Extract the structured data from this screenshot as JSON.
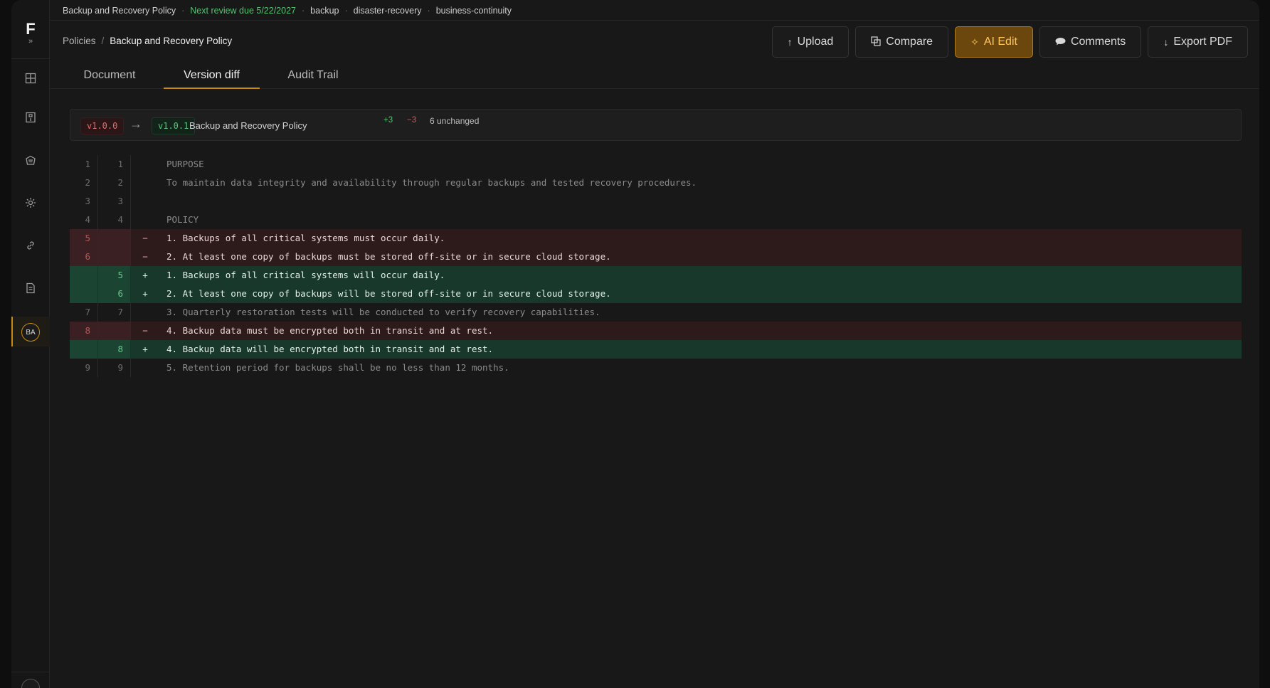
{
  "meta": {
    "doc_title": "Backup and Recovery Policy",
    "review": "Next review due 5/22/2027",
    "tags": [
      "backup",
      "disaster-recovery",
      "business-continuity"
    ]
  },
  "breadcrumb": {
    "parent": "Policies",
    "current": "Backup and Recovery Policy"
  },
  "sidebar": {
    "logo": "F",
    "logo_sub": "»",
    "avatar": "BA",
    "icons": [
      "dashboard-icon",
      "book-icon",
      "badge-icon",
      "gear-icon",
      "link-icon",
      "document-icon"
    ]
  },
  "actions": {
    "upload": "Upload",
    "compare": "Compare",
    "ai_edit": "AI Edit",
    "comments": "Comments",
    "export": "Export PDF"
  },
  "tabs": [
    {
      "label": "Document"
    },
    {
      "label": "Version diff"
    },
    {
      "label": "Audit Trail"
    }
  ],
  "active_tab": "Version diff",
  "version_bar": {
    "from": "v1.0.0",
    "to": "v1.0.1",
    "title": "Backup and Recovery Policy",
    "added": "+3",
    "removed": "−3",
    "unchanged": "6 unchanged"
  },
  "diff": [
    {
      "type": "ctx",
      "old": "1",
      "new": "1",
      "text": "PURPOSE"
    },
    {
      "type": "ctx",
      "old": "2",
      "new": "2",
      "text": "To maintain data integrity and availability through regular backups and tested recovery procedures."
    },
    {
      "type": "ctx",
      "old": "3",
      "new": "3",
      "text": ""
    },
    {
      "type": "ctx",
      "old": "4",
      "new": "4",
      "text": "POLICY"
    },
    {
      "type": "del",
      "old": "5",
      "new": "",
      "marker": "−",
      "text": "1. Backups of all critical systems must occur daily."
    },
    {
      "type": "del",
      "old": "6",
      "new": "",
      "marker": "−",
      "text": "2. At least one copy of backups must be stored off-site or in secure cloud storage."
    },
    {
      "type": "add",
      "old": "",
      "new": "5",
      "marker": "+",
      "text": "1. Backups of all critical systems will occur daily."
    },
    {
      "type": "add",
      "old": "",
      "new": "6",
      "marker": "+",
      "text": "2. At least one copy of backups will be stored off-site or in secure cloud storage."
    },
    {
      "type": "ctx",
      "old": "7",
      "new": "7",
      "text": "3. Quarterly restoration tests will be conducted to verify recovery capabilities."
    },
    {
      "type": "del",
      "old": "8",
      "new": "",
      "marker": "−",
      "text": "4. Backup data must be encrypted both in transit and at rest."
    },
    {
      "type": "add",
      "old": "",
      "new": "8",
      "marker": "+",
      "text": "4. Backup data will be encrypted both in transit and at rest."
    },
    {
      "type": "ctx",
      "old": "9",
      "new": "9",
      "text": "5. Retention period for backups shall be no less than 12 months."
    }
  ],
  "colors": {
    "accent": "#c98a12",
    "added": "#56c271",
    "removed": "#d85b5b"
  }
}
